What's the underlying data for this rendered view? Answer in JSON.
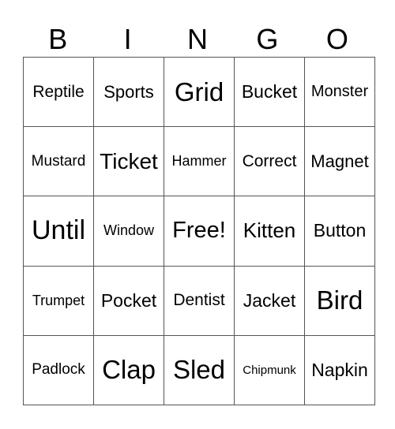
{
  "header": [
    "B",
    "I",
    "N",
    "G",
    "O"
  ],
  "cells": [
    [
      {
        "t": "Reptile",
        "s": 21
      },
      {
        "t": "Sports",
        "s": 22
      },
      {
        "t": "Grid",
        "s": 33
      },
      {
        "t": "Bucket",
        "s": 23
      },
      {
        "t": "Monster",
        "s": 20
      }
    ],
    [
      {
        "t": "Mustard",
        "s": 19
      },
      {
        "t": "Ticket",
        "s": 28
      },
      {
        "t": "Hammer",
        "s": 18
      },
      {
        "t": "Correct",
        "s": 21
      },
      {
        "t": "Magnet",
        "s": 22
      }
    ],
    [
      {
        "t": "Until",
        "s": 34
      },
      {
        "t": "Window",
        "s": 18
      },
      {
        "t": "Free!",
        "s": 29
      },
      {
        "t": "Kitten",
        "s": 26
      },
      {
        "t": "Button",
        "s": 23
      }
    ],
    [
      {
        "t": "Trumpet",
        "s": 18
      },
      {
        "t": "Pocket",
        "s": 23
      },
      {
        "t": "Dentist",
        "s": 21
      },
      {
        "t": "Jacket",
        "s": 23
      },
      {
        "t": "Bird",
        "s": 33
      }
    ],
    [
      {
        "t": "Padlock",
        "s": 19
      },
      {
        "t": "Clap",
        "s": 33
      },
      {
        "t": "Sled",
        "s": 33
      },
      {
        "t": "Chipmunk",
        "s": 15
      },
      {
        "t": "Napkin",
        "s": 23
      }
    ]
  ]
}
